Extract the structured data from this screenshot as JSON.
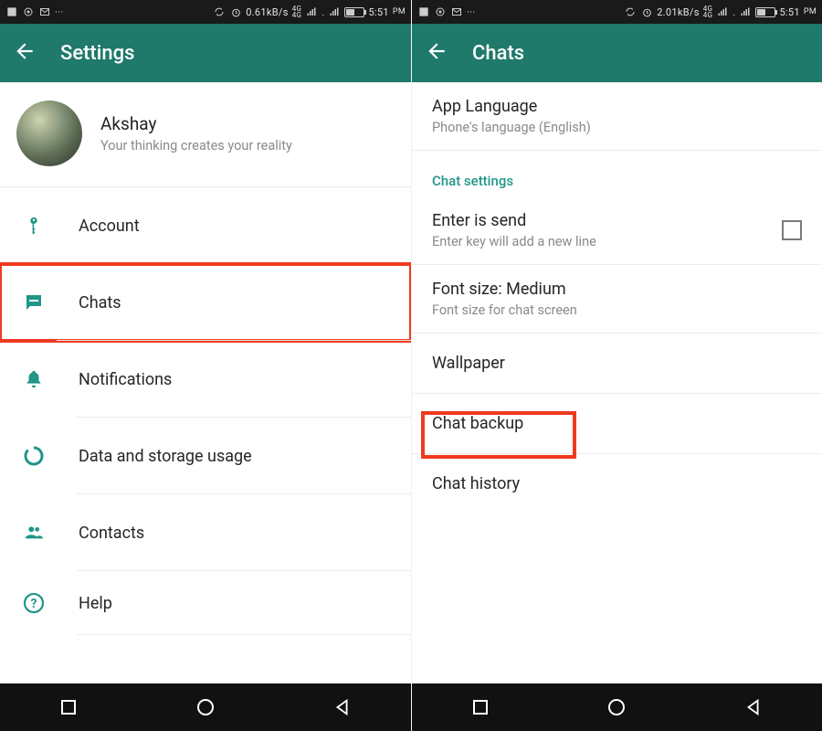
{
  "colors": {
    "appbar": "#1f7a6b",
    "teal": "#1f9688",
    "highlight": "#f03a1e"
  },
  "left": {
    "status": {
      "rate": "0.61kB/s",
      "net": "4G 4G",
      "time": "5:51",
      "ampm": "PM"
    },
    "appbar": {
      "title": "Settings"
    },
    "profile": {
      "name": "Akshay",
      "status": "Your thinking creates your reality"
    },
    "items": [
      {
        "key": "account",
        "label": "Account"
      },
      {
        "key": "chats",
        "label": "Chats",
        "highlighted": true
      },
      {
        "key": "notifications",
        "label": "Notifications"
      },
      {
        "key": "data",
        "label": "Data and storage usage"
      },
      {
        "key": "contacts",
        "label": "Contacts"
      },
      {
        "key": "help",
        "label": "Help"
      }
    ]
  },
  "right": {
    "status": {
      "rate": "2.01kB/s",
      "net": "4G 4G",
      "time": "5:51",
      "ampm": "PM"
    },
    "appbar": {
      "title": "Chats"
    },
    "app_language": {
      "title": "App Language",
      "sub": "Phone's language (English)"
    },
    "section": "Chat settings",
    "enter_is_send": {
      "title": "Enter is send",
      "sub": "Enter key will add a new line"
    },
    "font_size": {
      "title": "Font size: Medium",
      "sub": "Font size for chat screen"
    },
    "wallpaper": {
      "title": "Wallpaper"
    },
    "chat_backup": {
      "title": "Chat backup"
    },
    "chat_history": {
      "title": "Chat history"
    }
  }
}
